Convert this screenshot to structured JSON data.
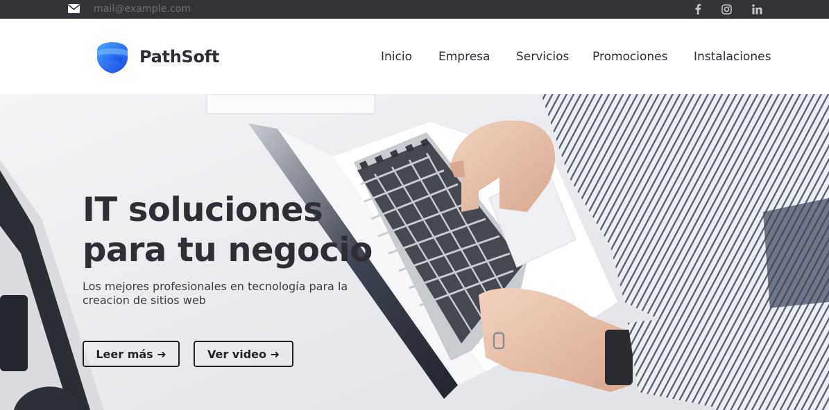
{
  "topbar": {
    "email": "mail@example.com",
    "icons": [
      "envelope-icon",
      "facebook-icon",
      "instagram-icon",
      "linkedin-icon"
    ]
  },
  "header": {
    "brand": "PathSoft",
    "nav": [
      "Inicio",
      "Empresa",
      "Servicios",
      "Promociones",
      "Instalaciones"
    ]
  },
  "hero": {
    "title_line1": "IT soluciones",
    "title_line2": "para tu negocio",
    "subtitle_line1": "Los mejores profesionales en tecnología para la",
    "subtitle_line2": "creacion de sitios web",
    "btn_read_more": "Leer más ➜",
    "btn_video": "Ver video ➜"
  },
  "colors": {
    "topbar": "#343338",
    "text_dark": "#2f2e36",
    "brand_blue": "#1e63f0"
  }
}
